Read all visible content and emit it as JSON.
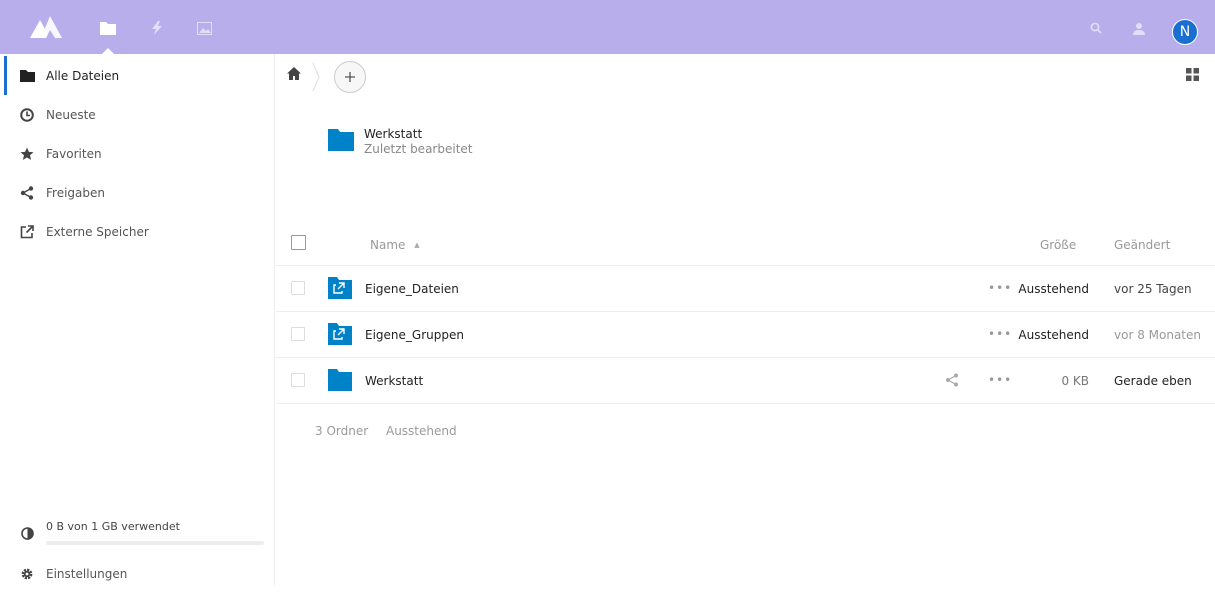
{
  "colors": {
    "header_bg": "#b9aeec",
    "accent": "#1a6fd0",
    "folder": "#0082c9"
  },
  "header": {
    "apps": [
      {
        "name": "files",
        "icon": "folder-icon"
      },
      {
        "name": "activity",
        "icon": "lightning-icon"
      },
      {
        "name": "gallery",
        "icon": "image-icon"
      }
    ],
    "avatar_initial": "N"
  },
  "sidebar": {
    "items": [
      {
        "label": "Alle Dateien",
        "icon": "folder-icon"
      },
      {
        "label": "Neueste",
        "icon": "clock-icon"
      },
      {
        "label": "Favoriten",
        "icon": "star-icon"
      },
      {
        "label": "Freigaben",
        "icon": "share-icon"
      },
      {
        "label": "Externe Speicher",
        "icon": "external-icon"
      }
    ],
    "quota_label": "0 B von 1 GB verwendet",
    "quota_fraction": 0,
    "settings_label": "Einstellungen"
  },
  "recent": {
    "name": "Werkstatt",
    "subtitle": "Zuletzt bearbeitet"
  },
  "table": {
    "headers": {
      "name": "Name",
      "sort_indicator": "▲",
      "size": "Größe",
      "modified": "Geändert"
    },
    "more_label": "•••",
    "rows": [
      {
        "name": "Eigene_Dateien",
        "type": "external-folder",
        "size": "Ausstehend",
        "modified": "vor 25 Tagen",
        "shared": false
      },
      {
        "name": "Eigene_Gruppen",
        "type": "external-folder",
        "size": "Ausstehend",
        "modified": "vor 8 Monaten",
        "shared": false
      },
      {
        "name": "Werkstatt",
        "type": "folder",
        "size": "0 KB",
        "modified": "Gerade eben",
        "shared": true
      }
    ]
  },
  "summary": {
    "count": "3 Ordner",
    "size": "Ausstehend"
  }
}
